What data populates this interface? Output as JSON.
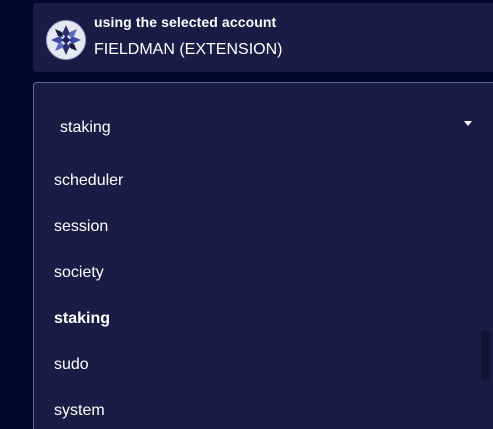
{
  "account": {
    "caption": "using the selected account",
    "name": "FIELDMAN (EXTENSION)",
    "avatar_icon": "identicon-icon"
  },
  "dropdown": {
    "selected_value": "staking",
    "caret_icon": "caret-down-icon",
    "options": [
      {
        "label": "scheduler",
        "selected": false
      },
      {
        "label": "session",
        "selected": false
      },
      {
        "label": "society",
        "selected": false
      },
      {
        "label": "staking",
        "selected": true
      },
      {
        "label": "sudo",
        "selected": false
      },
      {
        "label": "system",
        "selected": false
      }
    ]
  },
  "colors": {
    "background": "#05062b",
    "panel": "#1b1b45",
    "border": "#5a6aa6",
    "text": "#ffffff"
  }
}
